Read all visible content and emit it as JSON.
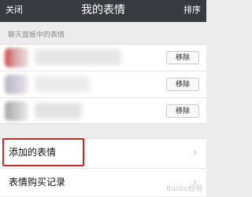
{
  "nav": {
    "left": "关闭",
    "title": "我的表情",
    "right": "排序"
  },
  "section": {
    "header": "聊天面板中的表情"
  },
  "stickers": [
    {
      "remove_label": "移除"
    },
    {
      "remove_label": "移除"
    },
    {
      "remove_label": "移除"
    }
  ],
  "menu": [
    {
      "label": "添加的表情",
      "highlighted": true
    },
    {
      "label": "表情购买记录"
    }
  ],
  "colors": {
    "nav_bg": "#393a3f",
    "highlight": "#d12727"
  },
  "watermark": "Baidu经验"
}
